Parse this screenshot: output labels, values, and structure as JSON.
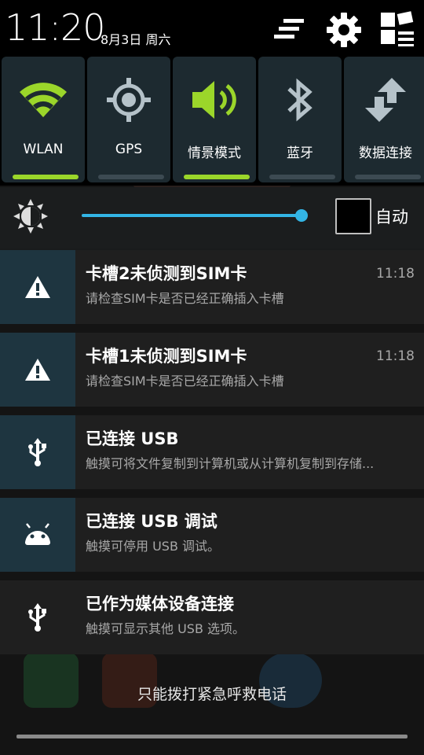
{
  "status": {
    "time": "11:20",
    "date": "8月3日 周六"
  },
  "header_icons": [
    "clear-notifications-icon",
    "settings-gear-icon",
    "quick-settings-grid-icon"
  ],
  "quick_settings": [
    {
      "label": "WLAN",
      "icon": "wifi-icon",
      "active": true
    },
    {
      "label": "GPS",
      "icon": "gps-icon",
      "active": false
    },
    {
      "label": "情景模式",
      "icon": "volume-icon",
      "active": true
    },
    {
      "label": "蓝牙",
      "icon": "bluetooth-icon",
      "active": false
    },
    {
      "label": "数据连接",
      "icon": "data-transfer-icon",
      "active": false
    }
  ],
  "brightness": {
    "auto_label": "自动",
    "auto_checked": false,
    "level": 0.98
  },
  "notifications": [
    {
      "title": "卡槽2未侦测到SIM卡",
      "subtitle": "请检查SIM卡是否已经正确插入卡槽",
      "time": "11:18",
      "icon": "warning-icon"
    },
    {
      "title": "卡槽1未侦测到SIM卡",
      "subtitle": "请检查SIM卡是否已经正确插入卡槽",
      "time": "11:18",
      "icon": "warning-icon"
    },
    {
      "title": "已连接 USB",
      "subtitle": "触摸可将文件复制到计算机或从计算机复制到存储...",
      "time": "",
      "icon": "usb-icon"
    },
    {
      "title": "已连接 USB 调试",
      "subtitle": "触摸可停用 USB 调试。",
      "time": "",
      "icon": "android-icon"
    },
    {
      "title": "已作为媒体设备连接",
      "subtitle": "触摸可显示其他 USB 选项。",
      "time": "",
      "icon": "usb-icon"
    }
  ],
  "emergency_text": "只能拨打紧急呼救电话",
  "colors": {
    "accent_green": "#9bd62a",
    "accent_blue": "#33b5e5"
  }
}
